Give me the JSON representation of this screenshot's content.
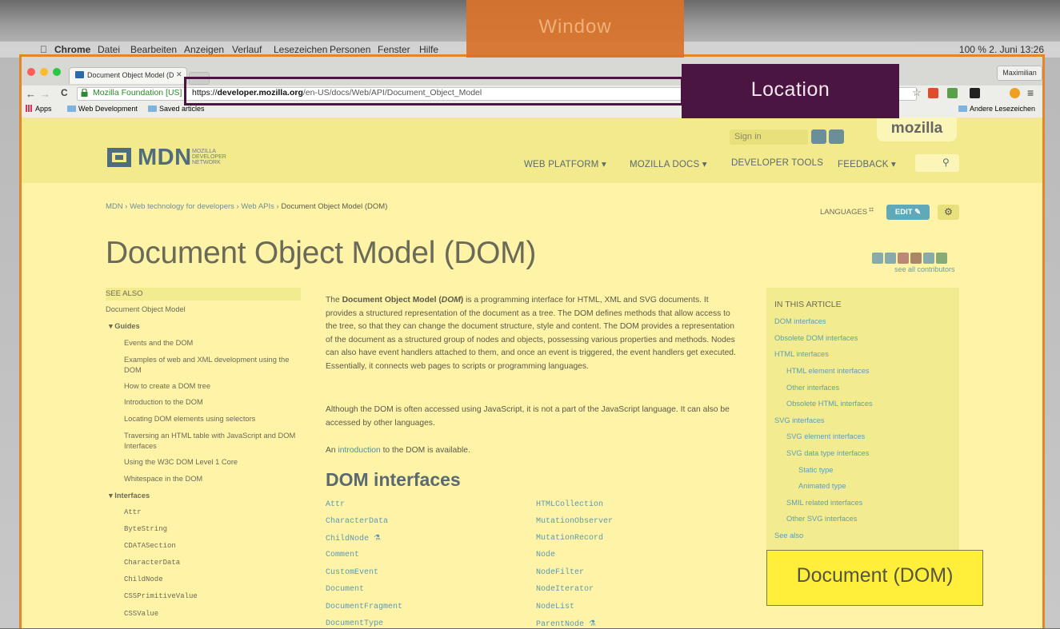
{
  "mac_menubar": {
    "items": [
      "Chrome",
      "Datei",
      "Bearbeiten",
      "Anzeigen",
      "Verlauf",
      "Lesezeichen",
      "Personen",
      "Fenster",
      "Hilfe"
    ],
    "status": "100 %  2. Juni 13:26"
  },
  "browser": {
    "tab_title": "Document Object Model (D",
    "profile": "Maximilian",
    "ev_label": "Mozilla Foundation [US]",
    "url_scheme": "https://",
    "url_host": "developer.mozilla.org",
    "url_path": "/en-US/docs/Web/API/Document_Object_Model",
    "bookmarks": [
      "Apps",
      "Web Development",
      "Saved articles"
    ],
    "other_bookmarks": "Andere Lesezeichen"
  },
  "header": {
    "logo_text": "MDN",
    "logo_sub": [
      "MOZILLA",
      "DEVELOPER",
      "NETWORK"
    ],
    "sign_in": "Sign in",
    "mozilla": "mozilla",
    "nav": [
      "WEB PLATFORM ▾",
      "MOZILLA DOCS ▾",
      "DEVELOPER TOOLS",
      "FEEDBACK ▾"
    ]
  },
  "breadcrumb": {
    "items": [
      "MDN",
      "Web technology for developers",
      "Web APIs"
    ],
    "current": "Document Object Model (DOM)"
  },
  "page_tools": {
    "languages": "LANGUAGES",
    "edit": "EDIT ✎",
    "see_contributors": "see all contributors"
  },
  "title": "Document Object Model (DOM)",
  "sidebar": {
    "see_also": "SEE ALSO",
    "top": "Document Object Model",
    "guides_label": "▾  Guides",
    "guides": [
      "Events and the DOM",
      "Examples of web and XML development using the",
      "DOM",
      "How to create a DOM tree",
      "Introduction to the DOM",
      "Locating DOM elements using selectors",
      "Traversing an HTML table with JavaScript and DOM",
      "Interfaces",
      "Using the W3C DOM Level 1 Core",
      "Whitespace in the DOM"
    ],
    "interfaces_label": "▾  Interfaces",
    "interfaces": [
      "Attr",
      "ByteString",
      "CDATASection",
      "CharacterData",
      "ChildNode",
      "CSSPrimitiveValue",
      "CSSValue"
    ]
  },
  "content": {
    "p1_pre": "The ",
    "p1_bold": "Document Object Model (",
    "p1_em": "DOM",
    "p1_bold2": ")",
    "p1_rest": " is a programming interface for HTML, XML and SVG documents. It provides a structured representation of the document as a tree. The DOM defines methods that allow access to the tree, so that they can change the document structure, style and content. The DOM provides a representation of the document as a structured group of nodes and objects, possessing various properties and methods. Nodes can also have event handlers attached to them, and once an event is triggered, the event handlers get executed. Essentially, it connects web pages to scripts or programming languages.",
    "p2": "Although the DOM is often accessed using JavaScript, it is not a part of the JavaScript language. It can also be accessed by other languages.",
    "p3_pre": "An ",
    "p3_link": "introduction",
    "p3_post": " to the DOM is available.",
    "h2": "DOM interfaces",
    "col1": [
      "Attr",
      "CharacterData",
      "ChildNode ⚗",
      "Comment",
      "CustomEvent",
      "Document",
      "DocumentFragment",
      "DocumentType"
    ],
    "col2": [
      "HTMLCollection",
      "MutationObserver",
      "MutationRecord",
      "Node",
      "NodeFilter",
      "NodeIterator",
      "NodeList",
      "ParentNode ⚗"
    ]
  },
  "toc": {
    "heading": "IN THIS ARTICLE",
    "items": [
      "DOM interfaces",
      "Obsolete DOM interfaces",
      "HTML interfaces",
      "HTML element interfaces",
      "Other interfaces",
      "Obsolete HTML interfaces",
      "SVG interfaces",
      "SVG element interfaces",
      "SVG data type interfaces",
      "Static type",
      "Animated type",
      "SMIL related interfaces",
      "Other SVG interfaces",
      "See also"
    ]
  },
  "overlays": {
    "window": "Window",
    "location": "Location",
    "document": "Document (DOM)"
  },
  "colors": {
    "window_overlay": "#d8732a",
    "location_overlay": "#4b1541",
    "document_overlay": "#ffee3a",
    "page_tint": "#fff3a8"
  }
}
